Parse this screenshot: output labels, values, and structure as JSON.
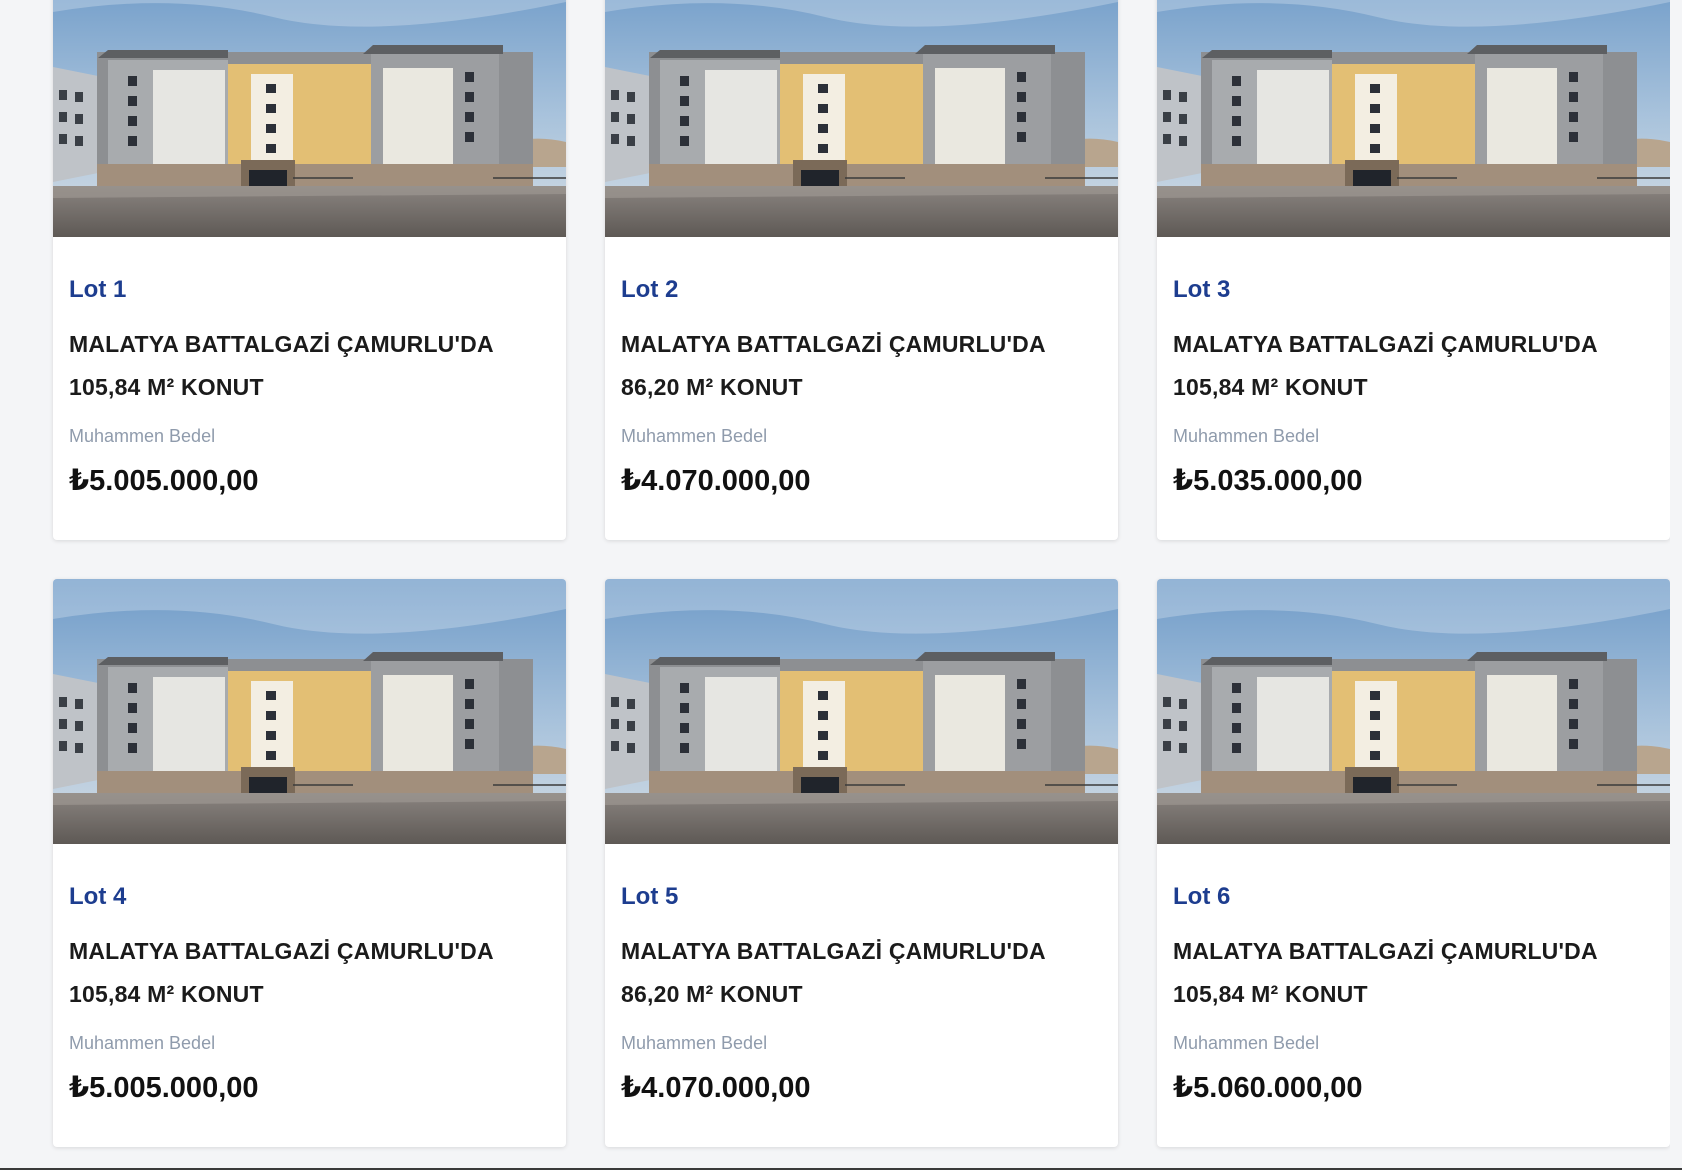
{
  "currency_symbol": "₺",
  "price_label": "Muhammen Bedel",
  "lots": [
    {
      "lot": "Lot 1",
      "title_line1": "MALATYA BATTALGAZİ ÇAMURLU'DA",
      "title_line2": "105,84 M² KONUT",
      "price_label": "Muhammen Bedel",
      "price": "₺5.005.000,00"
    },
    {
      "lot": "Lot 2",
      "title_line1": "MALATYA BATTALGAZİ ÇAMURLU'DA",
      "title_line2": "86,20 M² KONUT",
      "price_label": "Muhammen Bedel",
      "price": "₺4.070.000,00"
    },
    {
      "lot": "Lot 3",
      "title_line1": "MALATYA BATTALGAZİ ÇAMURLU'DA",
      "title_line2": "105,84 M² KONUT",
      "price_label": "Muhammen Bedel",
      "price": "₺5.035.000,00"
    },
    {
      "lot": "Lot 4",
      "title_line1": "MALATYA BATTALGAZİ ÇAMURLU'DA",
      "title_line2": "105,84 M² KONUT",
      "price_label": "Muhammen Bedel",
      "price": "₺5.005.000,00"
    },
    {
      "lot": "Lot 5",
      "title_line1": "MALATYA BATTALGAZİ ÇAMURLU'DA",
      "title_line2": "86,20 M² KONUT",
      "price_label": "Muhammen Bedel",
      "price": "₺4.070.000,00"
    },
    {
      "lot": "Lot 6",
      "title_line1": "MALATYA BATTALGAZİ ÇAMURLU'DA",
      "title_line2": "105,84 M² KONUT",
      "price_label": "Muhammen Bedel",
      "price": "₺5.060.000,00"
    }
  ],
  "colors": {
    "lot_link": "#1d3d8f",
    "label_gray": "#8f9bac",
    "page_bg": "#f4f5f7"
  }
}
